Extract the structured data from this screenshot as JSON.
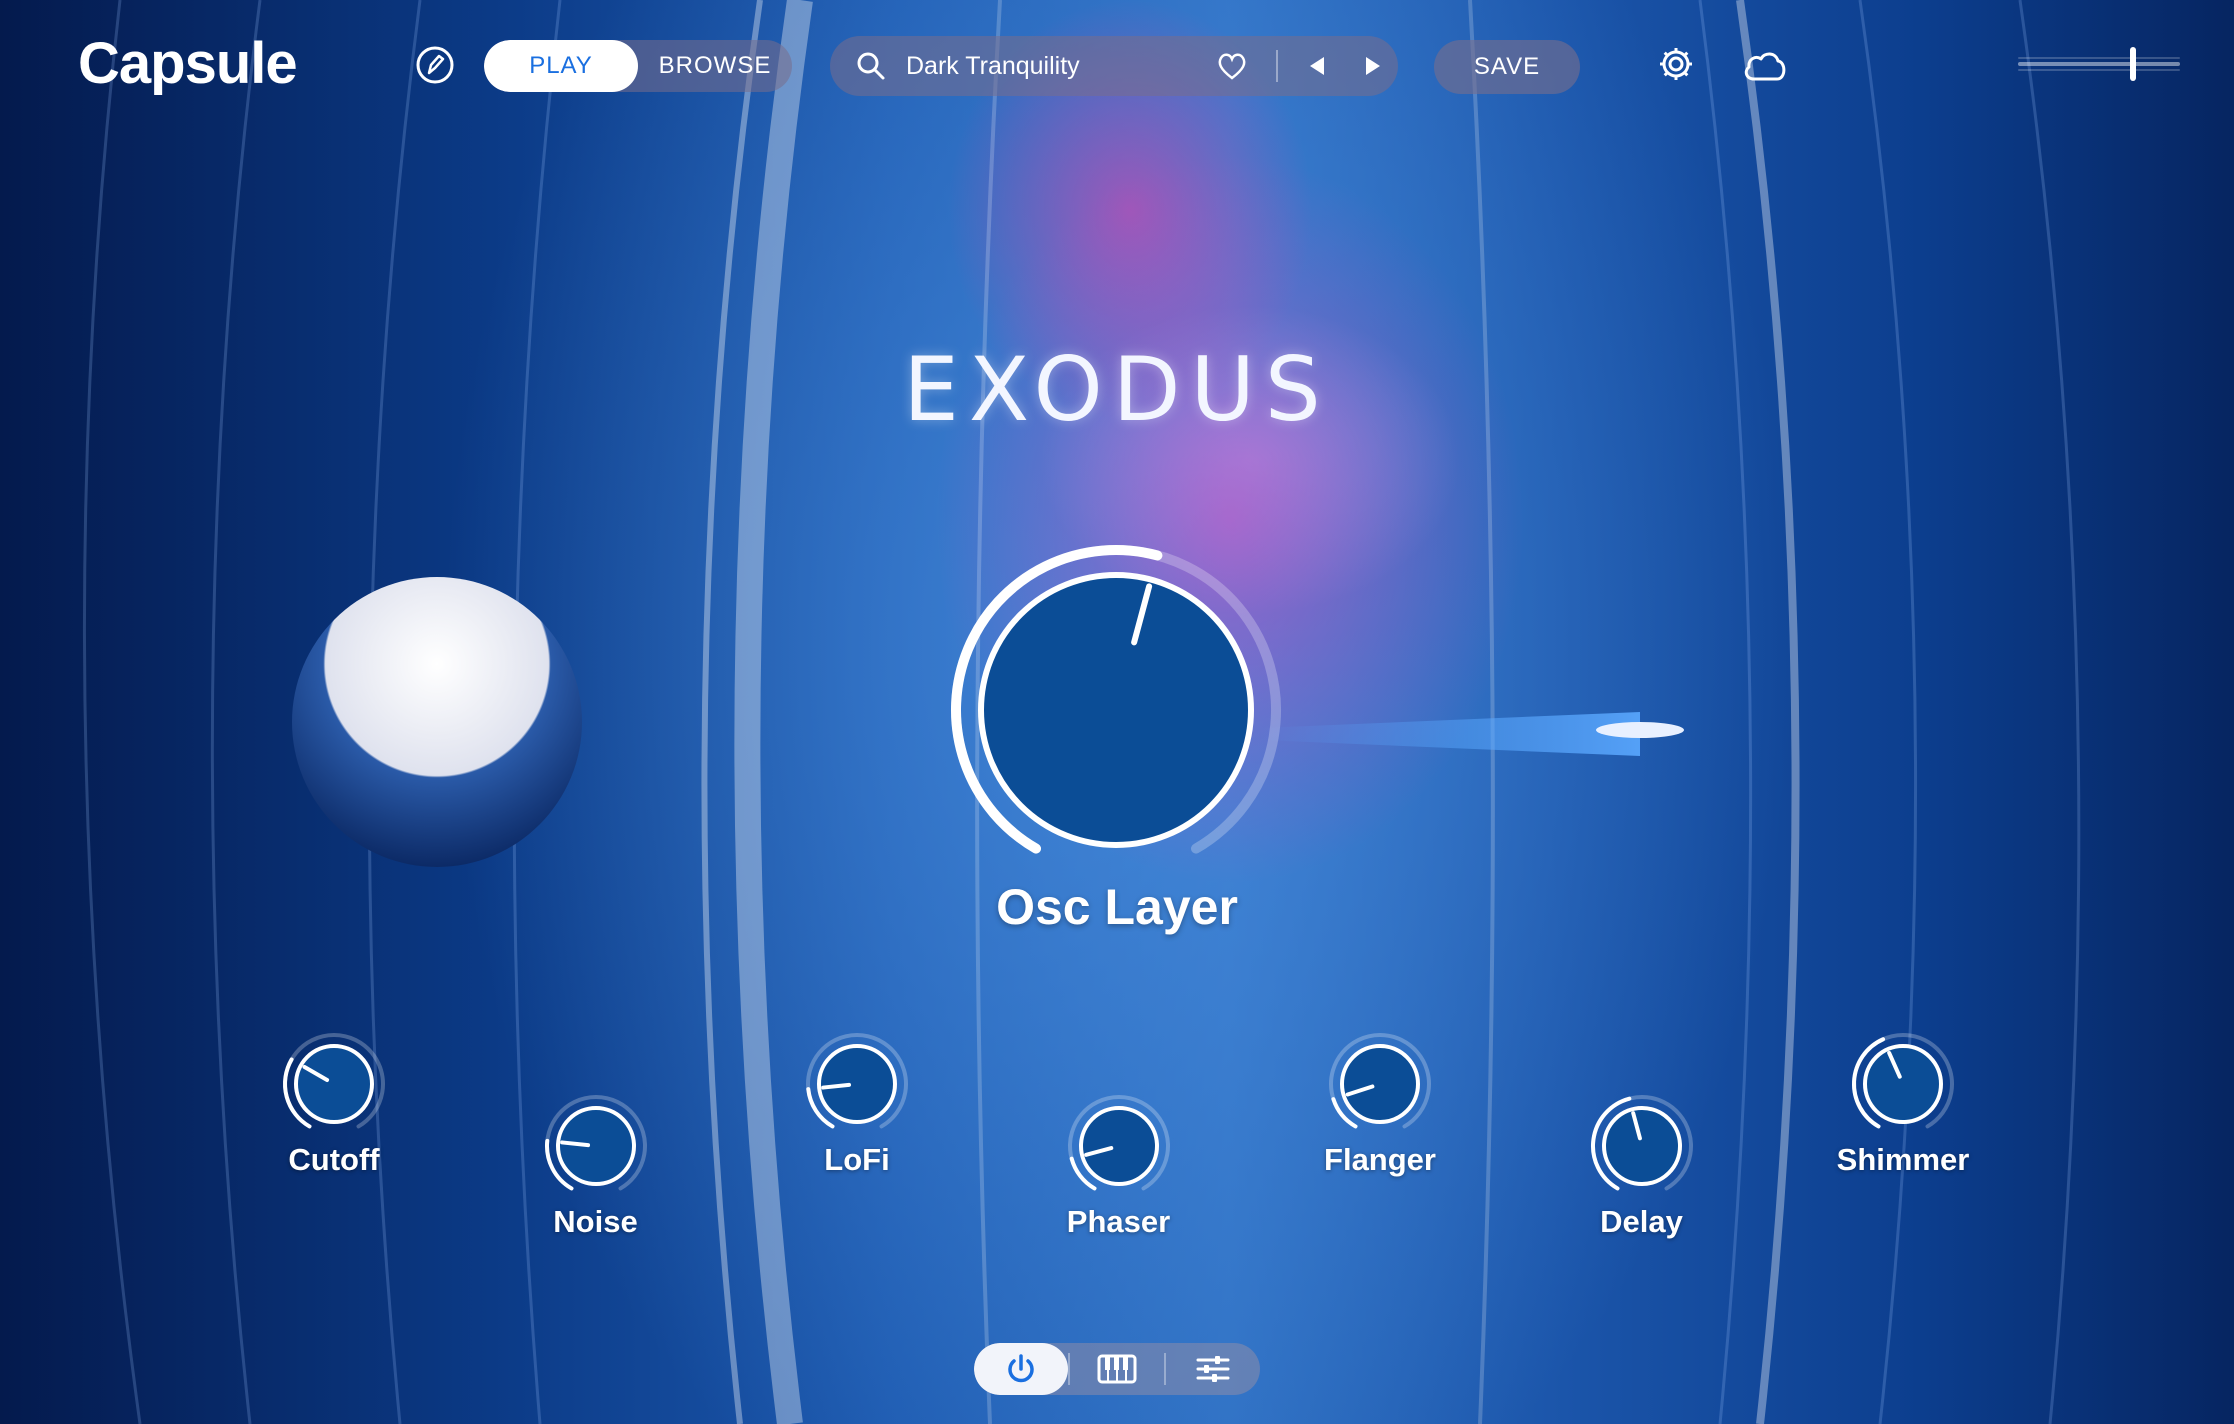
{
  "app": {
    "logo": "Capsule"
  },
  "header": {
    "mode_tabs": [
      {
        "label": "PLAY",
        "active": true
      },
      {
        "label": "BROWSE",
        "active": false
      }
    ],
    "preset": {
      "name": "Dark Tranquility",
      "icons": [
        "search-icon",
        "heart-icon",
        "prev-arrow-icon",
        "next-arrow-icon"
      ]
    },
    "save_label": "SAVE",
    "icons": [
      "pen-icon",
      "gear-icon",
      "cloud-icon",
      "volume-slider"
    ]
  },
  "instrument": {
    "title": "EXODUS"
  },
  "main_knob": {
    "label": "Osc Layer",
    "value_fraction": 0.55
  },
  "knobs": [
    {
      "label": "Cutoff",
      "value_fraction": 0.3
    },
    {
      "label": "Noise",
      "value_fraction": 0.22
    },
    {
      "label": "LoFi",
      "value_fraction": 0.18
    },
    {
      "label": "Phaser",
      "value_fraction": 0.15
    },
    {
      "label": "Flanger",
      "value_fraction": 0.14
    },
    {
      "label": "Delay",
      "value_fraction": 0.45
    },
    {
      "label": "Shimmer",
      "value_fraction": 0.42
    }
  ],
  "bottom_tabs": [
    {
      "icon": "power-icon",
      "active": true
    },
    {
      "icon": "piano-icon",
      "active": false
    },
    {
      "icon": "sliders-icon",
      "active": false
    }
  ],
  "colors": {
    "knob_fill": "#0b4d96",
    "accent": "#1a6fe0",
    "pill_bg": "#7a6e8c"
  }
}
